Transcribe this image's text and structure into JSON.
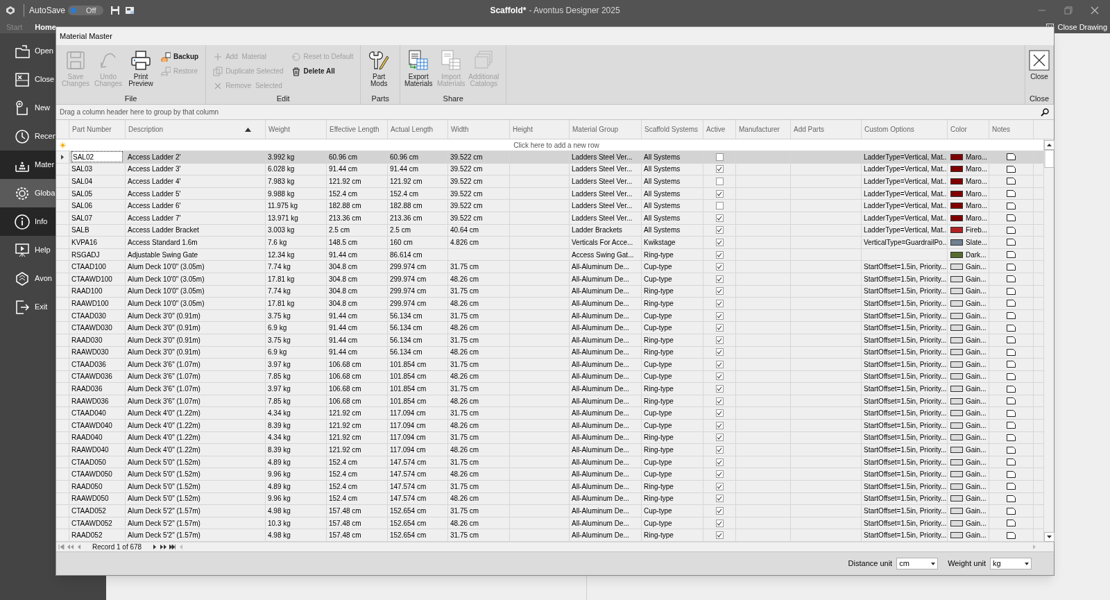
{
  "app": {
    "autosave_label": "AutoSave",
    "autosave": {
      "on": false,
      "label": "Off"
    },
    "title_document": "Scaffold*",
    "title_app": "- Avontus Designer 2025",
    "close_drawing": "Close Drawing"
  },
  "tabs": [
    {
      "label": "Start",
      "selected": false
    },
    {
      "label": "Home",
      "selected": true
    }
  ],
  "sidebar": {
    "items": [
      {
        "label": "Open",
        "highlighted": false,
        "hovered": false
      },
      {
        "label": "Close",
        "highlighted": false,
        "hovered": false
      },
      {
        "label": "New",
        "highlighted": false,
        "hovered": false
      },
      {
        "label": "Recen",
        "highlighted": false,
        "hovered": false
      },
      {
        "label": "Mater",
        "highlighted": true,
        "hovered": false
      },
      {
        "label": "Globa",
        "highlighted": false,
        "hovered": true
      },
      {
        "label": "Info",
        "highlighted": true,
        "hovered": false
      },
      {
        "label": "Help",
        "highlighted": false,
        "hovered": false
      },
      {
        "label": "Avon",
        "highlighted": false,
        "hovered": false
      },
      {
        "label": "Exit",
        "highlighted": false,
        "hovered": false
      }
    ]
  },
  "dialog": {
    "title": "Material Master",
    "ribbon": [
      {
        "label": "File",
        "buttons": [
          {
            "kind": "large",
            "label": "Save Changes",
            "disabled": true
          },
          {
            "kind": "large",
            "label": "Undo Changes",
            "disabled": true
          },
          {
            "kind": "large",
            "label": "Print Preview",
            "disabled": false
          },
          {
            "kind": "small",
            "label": "Backup",
            "disabled": false
          },
          {
            "kind": "small",
            "label": "Restore",
            "disabled": true
          }
        ]
      },
      {
        "label": "Edit",
        "buttons": [
          {
            "kind": "small",
            "label": "Add  Material",
            "disabled": true
          },
          {
            "kind": "small",
            "label": "Duplicate Selected",
            "disabled": true
          },
          {
            "kind": "small",
            "label": "Remove  Selected",
            "disabled": true
          },
          {
            "kind": "small",
            "label": "Reset to Default",
            "disabled": true
          },
          {
            "kind": "small",
            "label": "Delete All",
            "disabled": false
          }
        ]
      },
      {
        "label": "Parts",
        "buttons": [
          {
            "kind": "large",
            "label": "Part Mods",
            "disabled": false
          }
        ]
      },
      {
        "label": "Share",
        "buttons": [
          {
            "kind": "large",
            "label": "Export Materials",
            "disabled": false
          },
          {
            "kind": "large",
            "label": "Import Materials",
            "disabled": true
          },
          {
            "kind": "large",
            "label": "Additional Catalogs",
            "disabled": true
          }
        ]
      },
      {
        "label": "Close",
        "buttons": [
          {
            "kind": "large",
            "label": "Close",
            "disabled": false
          }
        ]
      }
    ],
    "group_panel_hint": "Drag a column header here to group by that column",
    "columns": [
      {
        "label": "Part Number",
        "sorted": false
      },
      {
        "label": "Description",
        "sorted": true
      },
      {
        "label": "Weight",
        "sorted": false
      },
      {
        "label": "Effective Length",
        "sorted": false
      },
      {
        "label": "Actual Length",
        "sorted": false
      },
      {
        "label": "Width",
        "sorted": false
      },
      {
        "label": "Height",
        "sorted": false
      },
      {
        "label": "Material Group",
        "sorted": false
      },
      {
        "label": "Scaffold Systems",
        "sorted": false
      },
      {
        "label": "Active",
        "sorted": false
      },
      {
        "label": "Manufacturer",
        "sorted": false
      },
      {
        "label": "Add Parts",
        "sorted": false
      },
      {
        "label": "Custom Options",
        "sorted": false
      },
      {
        "label": "Color",
        "sorted": false
      },
      {
        "label": "Notes",
        "sorted": false
      }
    ],
    "new_row_hint": "Click here to add a new row",
    "rows": [
      {
        "selected": true,
        "part_number": "SAL02",
        "description": "Access Ladder 2'",
        "weight": "3.992 kg",
        "effective_length": "60.96 cm",
        "actual_length": "60.96 cm",
        "width": "39.522 cm",
        "material_group": "Ladders Steel Ver...",
        "scaffold_systems": "All Systems",
        "active": false,
        "custom_options": "LadderType=Vertical, Mat...",
        "color_name": "Maro...",
        "color": "#800000"
      },
      {
        "selected": false,
        "part_number": "SAL03",
        "description": "Access Ladder 3'",
        "weight": "6.028 kg",
        "effective_length": "91.44 cm",
        "actual_length": "91.44 cm",
        "width": "39.522 cm",
        "material_group": "Ladders Steel Ver...",
        "scaffold_systems": "All Systems",
        "active": true,
        "custom_options": "LadderType=Vertical, Mat...",
        "color_name": "Maro...",
        "color": "#800000"
      },
      {
        "selected": false,
        "part_number": "SAL04",
        "description": "Access Ladder 4'",
        "weight": "7.983 kg",
        "effective_length": "121.92 cm",
        "actual_length": "121.92 cm",
        "width": "39.522 cm",
        "material_group": "Ladders Steel Ver...",
        "scaffold_systems": "All Systems",
        "active": false,
        "custom_options": "LadderType=Vertical, Mat...",
        "color_name": "Maro...",
        "color": "#800000"
      },
      {
        "selected": false,
        "part_number": "SAL05",
        "description": "Access Ladder 5'",
        "weight": "9.988 kg",
        "effective_length": "152.4 cm",
        "actual_length": "152.4 cm",
        "width": "39.522 cm",
        "material_group": "Ladders Steel Ver...",
        "scaffold_systems": "All Systems",
        "active": true,
        "custom_options": "LadderType=Vertical, Mat...",
        "color_name": "Maro...",
        "color": "#800000"
      },
      {
        "selected": false,
        "part_number": "SAL06",
        "description": "Access Ladder 6'",
        "weight": "11.975 kg",
        "effective_length": "182.88 cm",
        "actual_length": "182.88 cm",
        "width": "39.522 cm",
        "material_group": "Ladders Steel Ver...",
        "scaffold_systems": "All Systems",
        "active": false,
        "custom_options": "LadderType=Vertical, Mat...",
        "color_name": "Maro...",
        "color": "#800000"
      },
      {
        "selected": false,
        "part_number": "SAL07",
        "description": "Access Ladder 7'",
        "weight": "13.971 kg",
        "effective_length": "213.36 cm",
        "actual_length": "213.36 cm",
        "width": "39.522 cm",
        "material_group": "Ladders Steel Ver...",
        "scaffold_systems": "All Systems",
        "active": true,
        "custom_options": "LadderType=Vertical, Mat...",
        "color_name": "Maro...",
        "color": "#800000"
      },
      {
        "selected": false,
        "part_number": "SALB",
        "description": "Access Ladder Bracket",
        "weight": "3.003 kg",
        "effective_length": "2.5 cm",
        "actual_length": "2.5 cm",
        "width": "40.64 cm",
        "material_group": "Ladder Brackets",
        "scaffold_systems": "All Systems",
        "active": true,
        "custom_options": "LadderType=Vertical, Mat...",
        "color_name": "Fireb...",
        "color": "#b22222"
      },
      {
        "selected": false,
        "part_number": "KVPA16",
        "description": "Access Standard 1.6m",
        "weight": "7.6 kg",
        "effective_length": "148.5 cm",
        "actual_length": "160 cm",
        "width": "4.826 cm",
        "material_group": "Verticals For Acce...",
        "scaffold_systems": "Kwikstage",
        "active": true,
        "custom_options": "VerticalType=GuardrailPo...",
        "color_name": "Slate...",
        "color": "#708090"
      },
      {
        "selected": false,
        "part_number": "RSGADJ",
        "description": "Adjustable Swing Gate",
        "weight": "12.34 kg",
        "effective_length": "91.44 cm",
        "actual_length": "86.614 cm",
        "material_group": "Access Swing Gat...",
        "scaffold_systems": "Ring-type",
        "active": true,
        "color_name": "Dark...",
        "color": "#556b2f"
      },
      {
        "selected": false,
        "part_number": "CTAAD100",
        "description": "Alum Deck 10'0\" (3.05m)",
        "weight": "7.74 kg",
        "effective_length": "304.8 cm",
        "actual_length": "299.974 cm",
        "width": "31.75 cm",
        "material_group": "All-Aluminum De...",
        "scaffold_systems": "Cup-type",
        "active": true,
        "custom_options": "StartOffset=1.5in, Priority...",
        "color_name": "Gain...",
        "color": "#dcdcdc"
      },
      {
        "selected": false,
        "part_number": "CTAAWD100",
        "description": "Alum Deck 10'0\" (3.05m)",
        "weight": "17.81 kg",
        "effective_length": "304.8 cm",
        "actual_length": "299.974 cm",
        "width": "48.26 cm",
        "material_group": "All-Aluminum De...",
        "scaffold_systems": "Cup-type",
        "active": true,
        "custom_options": "StartOffset=1.5in, Priority...",
        "color_name": "Gain...",
        "color": "#dcdcdc"
      },
      {
        "selected": false,
        "part_number": "RAAD100",
        "description": "Alum Deck 10'0\" (3.05m)",
        "weight": "7.74 kg",
        "effective_length": "304.8 cm",
        "actual_length": "299.974 cm",
        "width": "31.75 cm",
        "material_group": "All-Aluminum De...",
        "scaffold_systems": "Ring-type",
        "active": true,
        "custom_options": "StartOffset=1.5in, Priority...",
        "color_name": "Gain...",
        "color": "#dcdcdc"
      },
      {
        "selected": false,
        "part_number": "RAAWD100",
        "description": "Alum Deck 10'0\" (3.05m)",
        "weight": "17.81 kg",
        "effective_length": "304.8 cm",
        "actual_length": "299.974 cm",
        "width": "48.26 cm",
        "material_group": "All-Aluminum De...",
        "scaffold_systems": "Ring-type",
        "active": true,
        "custom_options": "StartOffset=1.5in, Priority...",
        "color_name": "Gain...",
        "color": "#dcdcdc"
      },
      {
        "selected": false,
        "part_number": "CTAAD030",
        "description": "Alum Deck 3'0\" (0.91m)",
        "weight": "3.75 kg",
        "effective_length": "91.44 cm",
        "actual_length": "56.134 cm",
        "width": "31.75 cm",
        "material_group": "All-Aluminum De...",
        "scaffold_systems": "Cup-type",
        "active": true,
        "custom_options": "StartOffset=1.5in, Priority...",
        "color_name": "Gain...",
        "color": "#dcdcdc"
      },
      {
        "selected": false,
        "part_number": "CTAAWD030",
        "description": "Alum Deck 3'0\" (0.91m)",
        "weight": "6.9 kg",
        "effective_length": "91.44 cm",
        "actual_length": "56.134 cm",
        "width": "48.26 cm",
        "material_group": "All-Aluminum De...",
        "scaffold_systems": "Cup-type",
        "active": true,
        "custom_options": "StartOffset=1.5in, Priority...",
        "color_name": "Gain...",
        "color": "#dcdcdc"
      },
      {
        "selected": false,
        "part_number": "RAAD030",
        "description": "Alum Deck 3'0\" (0.91m)",
        "weight": "3.75 kg",
        "effective_length": "91.44 cm",
        "actual_length": "56.134 cm",
        "width": "31.75 cm",
        "material_group": "All-Aluminum De...",
        "scaffold_systems": "Ring-type",
        "active": true,
        "custom_options": "StartOffset=1.5in, Priority...",
        "color_name": "Gain...",
        "color": "#dcdcdc"
      },
      {
        "selected": false,
        "part_number": "RAAWD030",
        "description": "Alum Deck 3'0\" (0.91m)",
        "weight": "6.9 kg",
        "effective_length": "91.44 cm",
        "actual_length": "56.134 cm",
        "width": "48.26 cm",
        "material_group": "All-Aluminum De...",
        "scaffold_systems": "Ring-type",
        "active": true,
        "custom_options": "StartOffset=1.5in, Priority...",
        "color_name": "Gain...",
        "color": "#dcdcdc"
      },
      {
        "selected": false,
        "part_number": "CTAAD036",
        "description": "Alum Deck 3'6\" (1.07m)",
        "weight": "3.97 kg",
        "effective_length": "106.68 cm",
        "actual_length": "101.854 cm",
        "width": "31.75 cm",
        "material_group": "All-Aluminum De...",
        "scaffold_systems": "Cup-type",
        "active": true,
        "custom_options": "StartOffset=1.5in, Priority...",
        "color_name": "Gain...",
        "color": "#dcdcdc"
      },
      {
        "selected": false,
        "part_number": "CTAAWD036",
        "description": "Alum Deck 3'6\" (1.07m)",
        "weight": "7.85 kg",
        "effective_length": "106.68 cm",
        "actual_length": "101.854 cm",
        "width": "48.26 cm",
        "material_group": "All-Aluminum De...",
        "scaffold_systems": "Cup-type",
        "active": true,
        "custom_options": "StartOffset=1.5in, Priority...",
        "color_name": "Gain...",
        "color": "#dcdcdc"
      },
      {
        "selected": false,
        "part_number": "RAAD036",
        "description": "Alum Deck 3'6\" (1.07m)",
        "weight": "3.97 kg",
        "effective_length": "106.68 cm",
        "actual_length": "101.854 cm",
        "width": "31.75 cm",
        "material_group": "All-Aluminum De...",
        "scaffold_systems": "Ring-type",
        "active": true,
        "custom_options": "StartOffset=1.5in, Priority...",
        "color_name": "Gain...",
        "color": "#dcdcdc"
      },
      {
        "selected": false,
        "part_number": "RAAWD036",
        "description": "Alum Deck 3'6\" (1.07m)",
        "weight": "7.85 kg",
        "effective_length": "106.68 cm",
        "actual_length": "101.854 cm",
        "width": "48.26 cm",
        "material_group": "All-Aluminum De...",
        "scaffold_systems": "Ring-type",
        "active": true,
        "custom_options": "StartOffset=1.5in, Priority...",
        "color_name": "Gain...",
        "color": "#dcdcdc"
      },
      {
        "selected": false,
        "part_number": "CTAAD040",
        "description": "Alum Deck 4'0\" (1.22m)",
        "weight": "4.34 kg",
        "effective_length": "121.92 cm",
        "actual_length": "117.094 cm",
        "width": "31.75 cm",
        "material_group": "All-Aluminum De...",
        "scaffold_systems": "Cup-type",
        "active": true,
        "custom_options": "StartOffset=1.5in, Priority...",
        "color_name": "Gain...",
        "color": "#dcdcdc"
      },
      {
        "selected": false,
        "part_number": "CTAAWD040",
        "description": "Alum Deck 4'0\" (1.22m)",
        "weight": "8.39 kg",
        "effective_length": "121.92 cm",
        "actual_length": "117.094 cm",
        "width": "48.26 cm",
        "material_group": "All-Aluminum De...",
        "scaffold_systems": "Cup-type",
        "active": true,
        "custom_options": "StartOffset=1.5in, Priority...",
        "color_name": "Gain...",
        "color": "#dcdcdc"
      },
      {
        "selected": false,
        "part_number": "RAAD040",
        "description": "Alum Deck 4'0\" (1.22m)",
        "weight": "4.34 kg",
        "effective_length": "121.92 cm",
        "actual_length": "117.094 cm",
        "width": "31.75 cm",
        "material_group": "All-Aluminum De...",
        "scaffold_systems": "Ring-type",
        "active": true,
        "custom_options": "StartOffset=1.5in, Priority...",
        "color_name": "Gain...",
        "color": "#dcdcdc"
      },
      {
        "selected": false,
        "part_number": "RAAWD040",
        "description": "Alum Deck 4'0\" (1.22m)",
        "weight": "8.39 kg",
        "effective_length": "121.92 cm",
        "actual_length": "117.094 cm",
        "width": "48.26 cm",
        "material_group": "All-Aluminum De...",
        "scaffold_systems": "Ring-type",
        "active": true,
        "custom_options": "StartOffset=1.5in, Priority...",
        "color_name": "Gain...",
        "color": "#dcdcdc"
      },
      {
        "selected": false,
        "part_number": "CTAAD050",
        "description": "Alum Deck 5'0\" (1.52m)",
        "weight": "4.89 kg",
        "effective_length": "152.4 cm",
        "actual_length": "147.574 cm",
        "width": "31.75 cm",
        "material_group": "All-Aluminum De...",
        "scaffold_systems": "Cup-type",
        "active": true,
        "custom_options": "StartOffset=1.5in, Priority...",
        "color_name": "Gain...",
        "color": "#dcdcdc"
      },
      {
        "selected": false,
        "part_number": "CTAAWD050",
        "description": "Alum Deck 5'0\" (1.52m)",
        "weight": "9.96 kg",
        "effective_length": "152.4 cm",
        "actual_length": "147.574 cm",
        "width": "48.26 cm",
        "material_group": "All-Aluminum De...",
        "scaffold_systems": "Cup-type",
        "active": true,
        "custom_options": "StartOffset=1.5in, Priority...",
        "color_name": "Gain...",
        "color": "#dcdcdc"
      },
      {
        "selected": false,
        "part_number": "RAAD050",
        "description": "Alum Deck 5'0\" (1.52m)",
        "weight": "4.89 kg",
        "effective_length": "152.4 cm",
        "actual_length": "147.574 cm",
        "width": "31.75 cm",
        "material_group": "All-Aluminum De...",
        "scaffold_systems": "Ring-type",
        "active": true,
        "custom_options": "StartOffset=1.5in, Priority...",
        "color_name": "Gain...",
        "color": "#dcdcdc"
      },
      {
        "selected": false,
        "part_number": "RAAWD050",
        "description": "Alum Deck 5'0\" (1.52m)",
        "weight": "9.96 kg",
        "effective_length": "152.4 cm",
        "actual_length": "147.574 cm",
        "width": "48.26 cm",
        "material_group": "All-Aluminum De...",
        "scaffold_systems": "Ring-type",
        "active": true,
        "custom_options": "StartOffset=1.5in, Priority...",
        "color_name": "Gain...",
        "color": "#dcdcdc"
      },
      {
        "selected": false,
        "part_number": "CTAAD052",
        "description": "Alum Deck 5'2\" (1.57m)",
        "weight": "4.98 kg",
        "effective_length": "157.48 cm",
        "actual_length": "152.654 cm",
        "width": "31.75 cm",
        "material_group": "All-Aluminum De...",
        "scaffold_systems": "Cup-type",
        "active": true,
        "custom_options": "StartOffset=1.5in, Priority...",
        "color_name": "Gain...",
        "color": "#dcdcdc"
      },
      {
        "selected": false,
        "part_number": "CTAAWD052",
        "description": "Alum Deck 5'2\" (1.57m)",
        "weight": "10.3 kg",
        "effective_length": "157.48 cm",
        "actual_length": "152.654 cm",
        "width": "48.26 cm",
        "material_group": "All-Aluminum De...",
        "scaffold_systems": "Cup-type",
        "active": true,
        "custom_options": "StartOffset=1.5in, Priority...",
        "color_name": "Gain...",
        "color": "#dcdcdc"
      },
      {
        "selected": false,
        "part_number": "RAAD052",
        "description": "Alum Deck 5'2\" (1.57m)",
        "weight": "4.98 kg",
        "effective_length": "157.48 cm",
        "actual_length": "152.654 cm",
        "width": "31.75 cm",
        "material_group": "All-Aluminum De...",
        "scaffold_systems": "Ring-type",
        "active": true,
        "custom_options": "StartOffset=1.5in, Priority...",
        "color_name": "Gain...",
        "color": "#dcdcdc"
      }
    ],
    "record_navigator": "Record 1 of 678",
    "distance_unit": {
      "label": "Distance unit",
      "value": "cm"
    },
    "weight_unit": {
      "label": "Weight unit",
      "value": "kg"
    }
  }
}
